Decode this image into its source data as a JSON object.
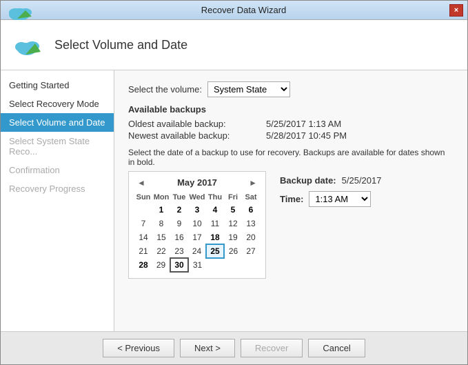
{
  "window": {
    "title": "Recover Data Wizard",
    "close_icon": "×"
  },
  "header": {
    "title": "Select Volume and Date"
  },
  "sidebar": {
    "items": [
      {
        "label": "Getting Started",
        "state": "normal"
      },
      {
        "label": "Select Recovery Mode",
        "state": "normal"
      },
      {
        "label": "Select Volume and Date",
        "state": "active"
      },
      {
        "label": "Select System State Reco...",
        "state": "disabled"
      },
      {
        "label": "Confirmation",
        "state": "disabled"
      },
      {
        "label": "Recovery Progress",
        "state": "disabled"
      }
    ]
  },
  "main": {
    "volume_label": "Select the volume:",
    "volume_value": "System State",
    "volume_options": [
      "System State"
    ],
    "available_backups_label": "Available backups",
    "oldest_label": "Oldest available backup:",
    "oldest_value": "5/25/2017 1:13 AM",
    "newest_label": "Newest available backup:",
    "newest_value": "5/28/2017 10:45 PM",
    "select_date_label": "Select the date of a backup to use for recovery. Backups are available for dates shown in bold.",
    "calendar": {
      "prev_nav": "◄",
      "next_nav": "►",
      "month_year": "May 2017",
      "day_headers": [
        "Sun",
        "Mon",
        "Tue",
        "Wed",
        "Thu",
        "Fri",
        "Sat"
      ],
      "weeks": [
        [
          null,
          "1",
          "2",
          "3",
          "4",
          "5",
          "6"
        ],
        [
          "7",
          "8",
          "9",
          "10",
          "11",
          "12",
          "13"
        ],
        [
          "14",
          "15",
          "16",
          "17",
          "18",
          "19",
          "20"
        ],
        [
          "21",
          "22",
          "23",
          "24",
          "25",
          "26",
          "27"
        ],
        [
          "28",
          "29",
          "30",
          "31",
          null,
          null,
          null
        ]
      ],
      "bold_dates": [
        "1",
        "2",
        "3",
        "4",
        "5",
        "6",
        "18",
        "25",
        "28",
        "30"
      ],
      "selected_date": "25",
      "today_date": "30"
    },
    "backup_date_label": "Backup date:",
    "backup_date_value": "5/25/2017",
    "time_label": "Time:",
    "time_value": "1:13 AM",
    "time_options": [
      "1:13 AM"
    ]
  },
  "footer": {
    "prev_label": "< Previous",
    "next_label": "Next >",
    "recover_label": "Recover",
    "cancel_label": "Cancel"
  }
}
